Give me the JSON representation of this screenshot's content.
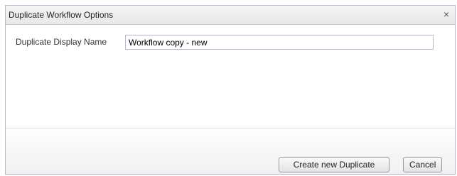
{
  "dialog": {
    "title": "Duplicate Workflow Options",
    "close_glyph": "×"
  },
  "form": {
    "name_label": "Duplicate Display Name",
    "name_value": "Workflow copy - new"
  },
  "buttons": {
    "create_label": "Create new Duplicate",
    "cancel_label": "Cancel"
  },
  "colors": {
    "border": "#b5b8c8",
    "titlebar": "#eeeeee"
  },
  "icons": {
    "close": "close-icon"
  }
}
